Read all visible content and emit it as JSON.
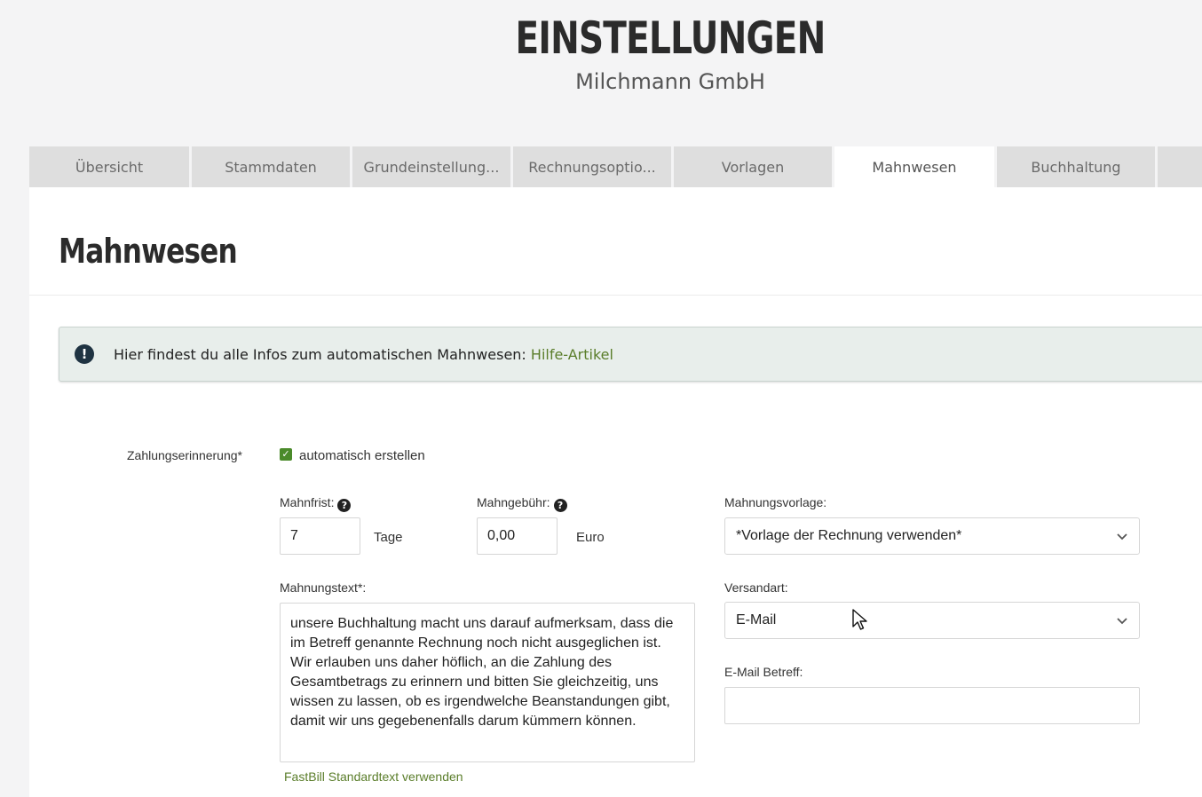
{
  "header": {
    "title": "EINSTELLUNGEN",
    "subtitle": "Milchmann GmbH"
  },
  "tabs": [
    {
      "label": "Übersicht",
      "active": false
    },
    {
      "label": "Stammdaten",
      "active": false
    },
    {
      "label": "Grundeinstellung...",
      "active": false
    },
    {
      "label": "Rechnungsoptio...",
      "active": false
    },
    {
      "label": "Vorlagen",
      "active": false
    },
    {
      "label": "Mahnwesen",
      "active": true
    },
    {
      "label": "Buchhaltung",
      "active": false
    },
    {
      "label": "",
      "active": false
    }
  ],
  "page": {
    "title": "Mahnwesen"
  },
  "info": {
    "icon": "exclamation-icon",
    "text": "Hier findest du alle Infos zum automatischen Mahnwesen: ",
    "link": "Hilfe-Artikel"
  },
  "form": {
    "zahlungserinnerung_label": "Zahlungserinnerung*",
    "auto_checkbox_label": "automatisch erstellen",
    "auto_checked": true,
    "mahnfrist_label": "Mahnfrist:",
    "mahnfrist_value": "7",
    "mahnfrist_unit": "Tage",
    "mahngebuehr_label": "Mahngebühr:",
    "mahngebuehr_value": "0,00",
    "mahngebuehr_unit": "Euro",
    "help_glyph": "?",
    "mahnungsvorlage_label": "Mahnungsvorlage:",
    "mahnungsvorlage_value": "*Vorlage der Rechnung verwenden*",
    "mahnungstext_label": "Mahnungstext*:",
    "mahnungstext_value": "unsere Buchhaltung macht uns darauf aufmerksam, dass die im Betreff genannte Rechnung noch nicht ausgeglichen ist. Wir erlauben uns daher höflich, an die Zahlung des Gesamtbetrags zu erinnern und bitten Sie gleichzeitig, uns wissen zu lassen, ob es irgendwelche Beanstandungen gibt, damit wir uns gegebenenfalls darum kümmern können.",
    "versandart_label": "Versandart:",
    "versandart_value": "E-Mail",
    "email_betreff_label": "E-Mail Betreff:",
    "email_betreff_value": "",
    "standardtext_link": "FastBill Standardtext verwenden"
  },
  "colors": {
    "accent_green": "#5a7d2a",
    "checkbox_green": "#4a8a2a",
    "info_bg": "#e8eeeb"
  }
}
